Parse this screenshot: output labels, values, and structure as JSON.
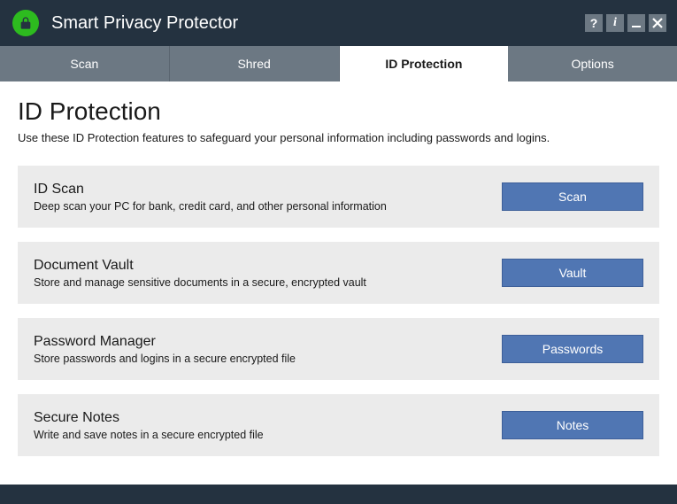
{
  "app": {
    "title": "Smart Privacy Protector"
  },
  "windowControls": {
    "help": "?",
    "info": "i"
  },
  "tabs": [
    {
      "label": "Scan",
      "active": false
    },
    {
      "label": "Shred",
      "active": false
    },
    {
      "label": "ID Protection",
      "active": true
    },
    {
      "label": "Options",
      "active": false
    }
  ],
  "page": {
    "heading": "ID Protection",
    "subtitle": "Use these ID Protection features to safeguard your personal information including passwords and logins."
  },
  "features": [
    {
      "title": "ID Scan",
      "desc": "Deep scan your PC for bank, credit card, and other personal information",
      "button": "Scan"
    },
    {
      "title": "Document Vault",
      "desc": "Store and manage sensitive documents in a secure, encrypted vault",
      "button": "Vault"
    },
    {
      "title": "Password Manager",
      "desc": "Store passwords and logins in a secure encrypted file",
      "button": "Passwords"
    },
    {
      "title": "Secure Notes",
      "desc": "Write and save notes in a secure encrypted file",
      "button": "Notes"
    }
  ]
}
